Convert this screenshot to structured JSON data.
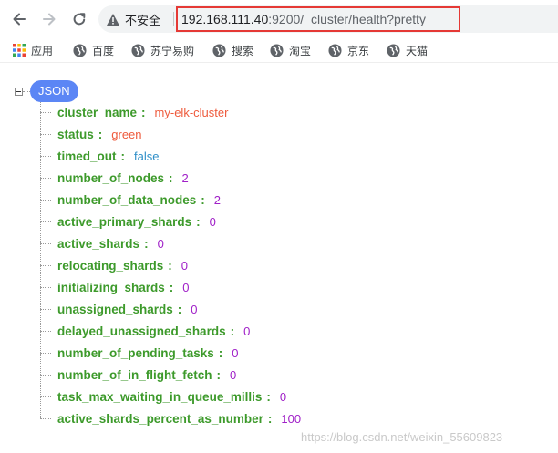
{
  "browser": {
    "security_label": "不安全",
    "url_host": "192.168.111.40",
    "url_path": ":9200/_cluster/health?pretty"
  },
  "bookmarks": [
    {
      "label": "应用",
      "icon": "apps-grid-icon"
    },
    {
      "label": "百度",
      "icon": "globe-icon"
    },
    {
      "label": "苏宁易购",
      "icon": "globe-icon"
    },
    {
      "label": "搜索",
      "icon": "globe-icon"
    },
    {
      "label": "淘宝",
      "icon": "globe-icon"
    },
    {
      "label": "京东",
      "icon": "globe-icon"
    },
    {
      "label": "天猫",
      "icon": "globe-icon"
    }
  ],
  "json_viewer": {
    "root_label": "JSON",
    "entries": [
      {
        "key": "cluster_name",
        "value": "my-elk-cluster",
        "type": "string"
      },
      {
        "key": "status",
        "value": "green",
        "type": "string"
      },
      {
        "key": "timed_out",
        "value": "false",
        "type": "boolean"
      },
      {
        "key": "number_of_nodes",
        "value": "2",
        "type": "number"
      },
      {
        "key": "number_of_data_nodes",
        "value": "2",
        "type": "number"
      },
      {
        "key": "active_primary_shards",
        "value": "0",
        "type": "number"
      },
      {
        "key": "active_shards",
        "value": "0",
        "type": "number"
      },
      {
        "key": "relocating_shards",
        "value": "0",
        "type": "number"
      },
      {
        "key": "initializing_shards",
        "value": "0",
        "type": "number"
      },
      {
        "key": "unassigned_shards",
        "value": "0",
        "type": "number"
      },
      {
        "key": "delayed_unassigned_shards",
        "value": "0",
        "type": "number"
      },
      {
        "key": "number_of_pending_tasks",
        "value": "0",
        "type": "number"
      },
      {
        "key": "number_of_in_flight_fetch",
        "value": "0",
        "type": "number"
      },
      {
        "key": "task_max_waiting_in_queue_millis",
        "value": "0",
        "type": "number"
      },
      {
        "key": "active_shards_percent_as_number",
        "value": "100",
        "type": "number"
      }
    ]
  },
  "watermark": "https://blog.csdn.net/weixin_55609823",
  "colors": {
    "key": "#3d9a2b",
    "string": "#ee5a3c",
    "boolean": "#2f8fc8",
    "number": "#a020c8",
    "badge": "#5b86f5",
    "url_highlight_border": "#e53935"
  }
}
